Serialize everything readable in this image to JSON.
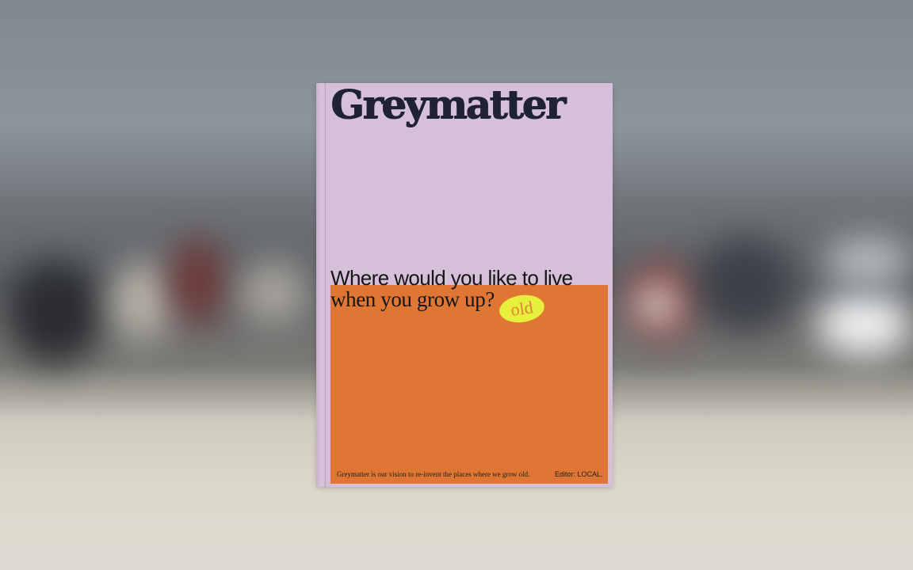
{
  "cover": {
    "logo_text": "Greymatter",
    "headline_line1": "Where would you like to live",
    "headline_line2": "when you grow up?",
    "sticker_word": "old",
    "footer_tagline": "Greymatter is our vision to re-invent the places where we grow old.",
    "footer_editor": "Editor: LOCAL."
  },
  "colors": {
    "cover_background": "#d6bfd8",
    "accent_block": "#df7633",
    "sticker": "#e6ef3c",
    "logo_ink": "#1f2237",
    "scene_top": "#7f8890",
    "scene_floor": "#dedbd0"
  }
}
